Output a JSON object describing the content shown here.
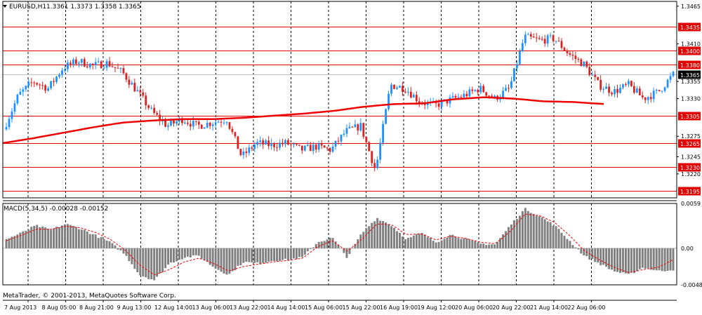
{
  "header": {
    "symbol_label": "EURUSD,H1",
    "ohlc": "1.3361 1.3373 1.3358 1.3365"
  },
  "indicator": {
    "label": "MACD(5,34,5) -0.00028 -0.00152"
  },
  "copyright": "MetaTrader, © 2001-2013, MetaQuotes Software Corp.",
  "colors": {
    "bull": "#1e90ff",
    "bear": "#e02020",
    "ma": "#ee0000",
    "level_line": "#e00000",
    "level_tag_bg": "#e00000",
    "macd_hist": "#808080",
    "macd_signal": "#ee0000",
    "grid": "#000000"
  },
  "chart_data": [
    {
      "type": "candlestick",
      "title": "EURUSD,H1",
      "y_ticks": [
        "1.3465",
        "1.3410",
        "1.3355",
        "1.3330",
        "1.3275",
        "1.3245",
        "1.3220"
      ],
      "ylim": [
        1.3185,
        1.3472
      ],
      "level_lines": [
        "1.3435",
        "1.3400",
        "1.3380",
        "1.3305",
        "1.3265",
        "1.3230",
        "1.3195"
      ],
      "current_price": "1.3365",
      "x_tick_labels": [
        "7 Aug 2013",
        "8 Aug 05:00",
        "8 Aug 21:00",
        "9 Aug 13:00",
        "12 Aug 14:00",
        "13 Aug 06:00",
        "13 Aug 22:00",
        "14 Aug 14:00",
        "15 Aug 06:00",
        "15 Aug 22:00",
        "16 Aug 19:00",
        "19 Aug 12:00",
        "20 Aug 06:00",
        "20 Aug 22:00",
        "21 Aug 14:00",
        "22 Aug 06:00"
      ],
      "close_path": [
        1.3285,
        1.3335,
        1.3355,
        1.3345,
        1.3375,
        1.3385,
        1.3378,
        1.3382,
        1.3368,
        1.334,
        1.331,
        1.329,
        1.33,
        1.329,
        1.3295,
        1.33,
        1.3245,
        1.3265,
        1.3262,
        1.3265,
        1.3255,
        1.326,
        1.3255,
        1.3282,
        1.329,
        1.3225,
        1.335,
        1.3345,
        1.3325,
        1.332,
        1.3328,
        1.3335,
        1.3345,
        1.333,
        1.3345,
        1.342,
        1.3415,
        1.3418,
        1.3395,
        1.338,
        1.335,
        1.334,
        1.335,
        1.333,
        1.334,
        1.3365
      ],
      "moving_average": [
        1.3265,
        1.3272,
        1.328,
        1.3288,
        1.3295,
        1.3298,
        1.33,
        1.33,
        1.3302,
        1.3305,
        1.3308,
        1.3312,
        1.3318,
        1.3322,
        1.3323,
        1.3329,
        1.3332,
        1.333,
        1.3326,
        1.3325,
        1.3322
      ],
      "macd": {
        "label": "MACD(5,34,5)",
        "y_ticks": [
          "0.0059",
          "0.00",
          "-0.00481"
        ],
        "ylim": [
          -0.00481,
          0.0059
        ],
        "histogram_path": [
          0.0012,
          0.002,
          0.003,
          0.0024,
          0.0032,
          0.0026,
          0.0017,
          0.0008,
          -0.0008,
          -0.0035,
          -0.0042,
          -0.002,
          -0.0012,
          -0.001,
          -0.0025,
          -0.0035,
          -0.0018,
          -0.002,
          -0.0016,
          -0.0015,
          -0.0012,
          0.0008,
          0.0014,
          -0.0012,
          0.002,
          0.004,
          0.003,
          0.0012,
          0.002,
          0.0008,
          0.0018,
          0.0012,
          0.0006,
          0.0005,
          0.003,
          0.0052,
          0.0042,
          0.003,
          0.001,
          -0.001,
          -0.002,
          -0.003,
          -0.0035,
          -0.0025,
          -0.003,
          -0.0028
        ],
        "signal_path": [
          0.001,
          0.0017,
          0.0025,
          0.0025,
          0.0029,
          0.0027,
          0.0021,
          0.0012,
          -0.0002,
          -0.0022,
          -0.0035,
          -0.0028,
          -0.0018,
          -0.0013,
          -0.002,
          -0.003,
          -0.0024,
          -0.0021,
          -0.0018,
          -0.0016,
          -0.0013,
          0.0002,
          0.001,
          -0.0004,
          0.0012,
          0.0032,
          0.0031,
          0.0018,
          0.0019,
          0.0011,
          0.0016,
          0.0013,
          0.0008,
          0.0006,
          0.0022,
          0.0045,
          0.0043,
          0.0034,
          0.0017,
          -0.0003,
          -0.0015,
          -0.0025,
          -0.0032,
          -0.0028,
          -0.0025,
          -0.0015
        ]
      }
    }
  ]
}
